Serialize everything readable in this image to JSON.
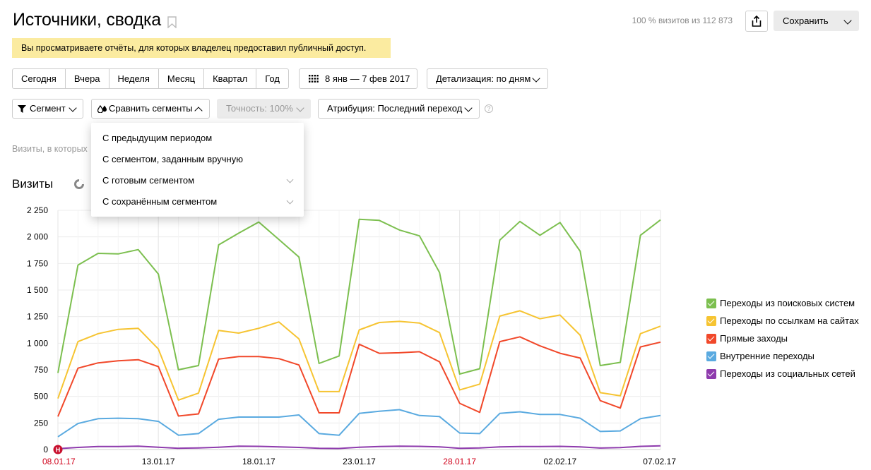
{
  "header": {
    "title": "Источники, сводка",
    "visits_share": "100 % визитов из 112 873",
    "save_label": "Сохранить"
  },
  "notice": "Вы просматриваете отчёты, для которых владелец предоставил публичный доступ.",
  "periods": [
    "Сегодня",
    "Вчера",
    "Неделя",
    "Месяц",
    "Квартал",
    "Год"
  ],
  "date_range": "8 янв — 7 фев 2017",
  "detail": "Детализация: по дням",
  "segment_label": "Сегмент",
  "compare_label": "Сравнить сегменты",
  "accuracy_label": "Точность: 100%",
  "attribution_label": "Атрибуция: Последний переход",
  "help": "?",
  "visits_note": "Визиты, в которых",
  "compare_menu": [
    "С предыдущим периодом",
    "С сегментом, заданным вручную",
    "С готовым сегментом",
    "С сохранённым сегментом"
  ],
  "chart_title": "Визиты",
  "chart_data": {
    "type": "line",
    "ylim": [
      0,
      2250
    ],
    "y_ticks": [
      "0",
      "250",
      "500",
      "750",
      "1 000",
      "1 250",
      "1 500",
      "1 750",
      "2 000",
      "2 250"
    ],
    "x_tick_labels": [
      {
        "index": 0,
        "label": "08.01.17",
        "weekend": true
      },
      {
        "index": 5,
        "label": "13.01.17",
        "weekend": false
      },
      {
        "index": 10,
        "label": "18.01.17",
        "weekend": false
      },
      {
        "index": 15,
        "label": "23.01.17",
        "weekend": false
      },
      {
        "index": 20,
        "label": "28.01.17",
        "weekend": true
      },
      {
        "index": 25,
        "label": "02.02.17",
        "weekend": false
      },
      {
        "index": 30,
        "label": "07.02.17",
        "weekend": false
      }
    ],
    "marker_label": "Н",
    "series": [
      {
        "name": "Переходы из поисковых систем",
        "color": "#7cbf4f",
        "values": [
          720,
          1735,
          1845,
          1840,
          1880,
          1650,
          750,
          790,
          1925,
          2035,
          2140,
          1975,
          1810,
          810,
          880,
          2165,
          2155,
          2065,
          2010,
          1665,
          710,
          760,
          1970,
          2145,
          2015,
          2135,
          1865,
          790,
          820,
          2015,
          2160
        ]
      },
      {
        "name": "Переходы по ссылкам на сайтах",
        "color": "#f6c432",
        "values": [
          480,
          1015,
          1090,
          1130,
          1140,
          945,
          465,
          530,
          1120,
          1095,
          1140,
          1200,
          1040,
          545,
          545,
          1125,
          1195,
          1205,
          1190,
          1100,
          560,
          615,
          1255,
          1305,
          1230,
          1265,
          1075,
          535,
          505,
          1090,
          1160
        ]
      },
      {
        "name": "Прямые заходы",
        "color": "#f1482a",
        "values": [
          310,
          765,
          815,
          835,
          845,
          780,
          315,
          335,
          850,
          875,
          875,
          855,
          795,
          345,
          345,
          990,
          905,
          910,
          920,
          825,
          435,
          350,
          1015,
          1060,
          975,
          905,
          860,
          460,
          390,
          965,
          1010
        ]
      },
      {
        "name": "Внутренние переходы",
        "color": "#5aaae0",
        "values": [
          120,
          245,
          290,
          295,
          290,
          265,
          135,
          150,
          285,
          305,
          305,
          305,
          325,
          150,
          135,
          340,
          360,
          375,
          320,
          310,
          155,
          150,
          340,
          355,
          330,
          330,
          295,
          170,
          175,
          290,
          320
        ]
      },
      {
        "name": "Переходы из социальных сетей",
        "color": "#8e3bad",
        "values": [
          8,
          20,
          28,
          28,
          32,
          22,
          12,
          15,
          22,
          32,
          30,
          25,
          20,
          12,
          10,
          22,
          28,
          32,
          30,
          25,
          12,
          15,
          25,
          28,
          28,
          30,
          25,
          14,
          18,
          30,
          35
        ]
      }
    ]
  }
}
